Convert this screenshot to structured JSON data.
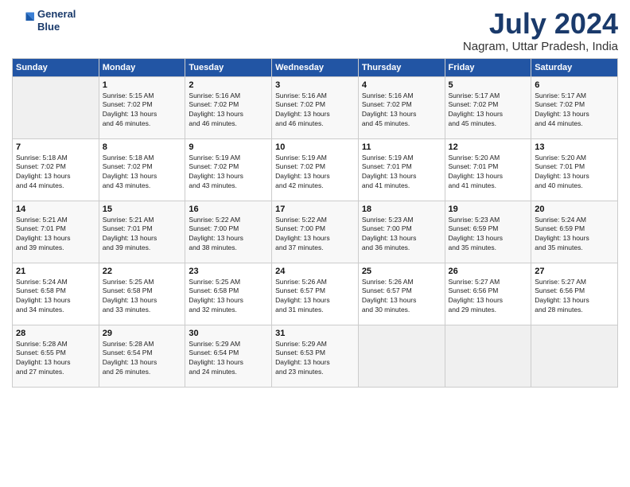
{
  "header": {
    "logo_line1": "General",
    "logo_line2": "Blue",
    "title": "July 2024",
    "subtitle": "Nagram, Uttar Pradesh, India"
  },
  "calendar": {
    "headers": [
      "Sunday",
      "Monday",
      "Tuesday",
      "Wednesday",
      "Thursday",
      "Friday",
      "Saturday"
    ],
    "weeks": [
      [
        {
          "num": "",
          "info": ""
        },
        {
          "num": "1",
          "info": "Sunrise: 5:15 AM\nSunset: 7:02 PM\nDaylight: 13 hours\nand 46 minutes."
        },
        {
          "num": "2",
          "info": "Sunrise: 5:16 AM\nSunset: 7:02 PM\nDaylight: 13 hours\nand 46 minutes."
        },
        {
          "num": "3",
          "info": "Sunrise: 5:16 AM\nSunset: 7:02 PM\nDaylight: 13 hours\nand 46 minutes."
        },
        {
          "num": "4",
          "info": "Sunrise: 5:16 AM\nSunset: 7:02 PM\nDaylight: 13 hours\nand 45 minutes."
        },
        {
          "num": "5",
          "info": "Sunrise: 5:17 AM\nSunset: 7:02 PM\nDaylight: 13 hours\nand 45 minutes."
        },
        {
          "num": "6",
          "info": "Sunrise: 5:17 AM\nSunset: 7:02 PM\nDaylight: 13 hours\nand 44 minutes."
        }
      ],
      [
        {
          "num": "7",
          "info": "Sunrise: 5:18 AM\nSunset: 7:02 PM\nDaylight: 13 hours\nand 44 minutes."
        },
        {
          "num": "8",
          "info": "Sunrise: 5:18 AM\nSunset: 7:02 PM\nDaylight: 13 hours\nand 43 minutes."
        },
        {
          "num": "9",
          "info": "Sunrise: 5:19 AM\nSunset: 7:02 PM\nDaylight: 13 hours\nand 43 minutes."
        },
        {
          "num": "10",
          "info": "Sunrise: 5:19 AM\nSunset: 7:02 PM\nDaylight: 13 hours\nand 42 minutes."
        },
        {
          "num": "11",
          "info": "Sunrise: 5:19 AM\nSunset: 7:01 PM\nDaylight: 13 hours\nand 41 minutes."
        },
        {
          "num": "12",
          "info": "Sunrise: 5:20 AM\nSunset: 7:01 PM\nDaylight: 13 hours\nand 41 minutes."
        },
        {
          "num": "13",
          "info": "Sunrise: 5:20 AM\nSunset: 7:01 PM\nDaylight: 13 hours\nand 40 minutes."
        }
      ],
      [
        {
          "num": "14",
          "info": "Sunrise: 5:21 AM\nSunset: 7:01 PM\nDaylight: 13 hours\nand 39 minutes."
        },
        {
          "num": "15",
          "info": "Sunrise: 5:21 AM\nSunset: 7:01 PM\nDaylight: 13 hours\nand 39 minutes."
        },
        {
          "num": "16",
          "info": "Sunrise: 5:22 AM\nSunset: 7:00 PM\nDaylight: 13 hours\nand 38 minutes."
        },
        {
          "num": "17",
          "info": "Sunrise: 5:22 AM\nSunset: 7:00 PM\nDaylight: 13 hours\nand 37 minutes."
        },
        {
          "num": "18",
          "info": "Sunrise: 5:23 AM\nSunset: 7:00 PM\nDaylight: 13 hours\nand 36 minutes."
        },
        {
          "num": "19",
          "info": "Sunrise: 5:23 AM\nSunset: 6:59 PM\nDaylight: 13 hours\nand 35 minutes."
        },
        {
          "num": "20",
          "info": "Sunrise: 5:24 AM\nSunset: 6:59 PM\nDaylight: 13 hours\nand 35 minutes."
        }
      ],
      [
        {
          "num": "21",
          "info": "Sunrise: 5:24 AM\nSunset: 6:58 PM\nDaylight: 13 hours\nand 34 minutes."
        },
        {
          "num": "22",
          "info": "Sunrise: 5:25 AM\nSunset: 6:58 PM\nDaylight: 13 hours\nand 33 minutes."
        },
        {
          "num": "23",
          "info": "Sunrise: 5:25 AM\nSunset: 6:58 PM\nDaylight: 13 hours\nand 32 minutes."
        },
        {
          "num": "24",
          "info": "Sunrise: 5:26 AM\nSunset: 6:57 PM\nDaylight: 13 hours\nand 31 minutes."
        },
        {
          "num": "25",
          "info": "Sunrise: 5:26 AM\nSunset: 6:57 PM\nDaylight: 13 hours\nand 30 minutes."
        },
        {
          "num": "26",
          "info": "Sunrise: 5:27 AM\nSunset: 6:56 PM\nDaylight: 13 hours\nand 29 minutes."
        },
        {
          "num": "27",
          "info": "Sunrise: 5:27 AM\nSunset: 6:56 PM\nDaylight: 13 hours\nand 28 minutes."
        }
      ],
      [
        {
          "num": "28",
          "info": "Sunrise: 5:28 AM\nSunset: 6:55 PM\nDaylight: 13 hours\nand 27 minutes."
        },
        {
          "num": "29",
          "info": "Sunrise: 5:28 AM\nSunset: 6:54 PM\nDaylight: 13 hours\nand 26 minutes."
        },
        {
          "num": "30",
          "info": "Sunrise: 5:29 AM\nSunset: 6:54 PM\nDaylight: 13 hours\nand 24 minutes."
        },
        {
          "num": "31",
          "info": "Sunrise: 5:29 AM\nSunset: 6:53 PM\nDaylight: 13 hours\nand 23 minutes."
        },
        {
          "num": "",
          "info": ""
        },
        {
          "num": "",
          "info": ""
        },
        {
          "num": "",
          "info": ""
        }
      ]
    ]
  }
}
